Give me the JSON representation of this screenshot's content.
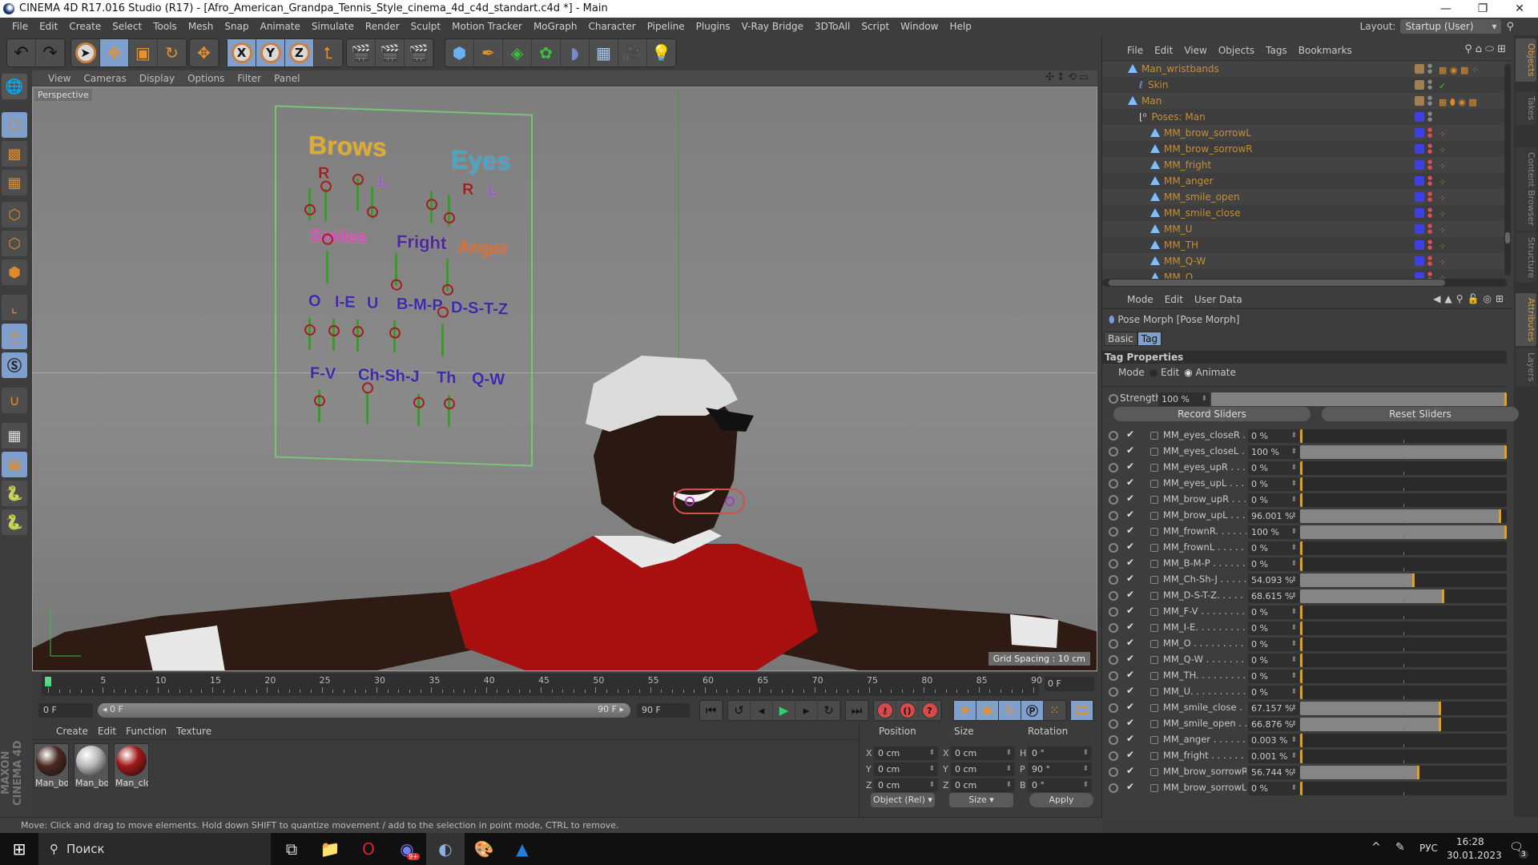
{
  "window": {
    "title": "CINEMA 4D R17.016 Studio (R17) - [Afro_American_Grandpa_Tennis_Style_cinema_4d_c4d_standart.c4d *] - Main",
    "minimize": "—",
    "restore": "❐",
    "close": "✕"
  },
  "menubar": [
    "File",
    "Edit",
    "Create",
    "Select",
    "Tools",
    "Mesh",
    "Snap",
    "Animate",
    "Simulate",
    "Render",
    "Sculpt",
    "Motion Tracker",
    "MoGraph",
    "Character",
    "Pipeline",
    "Plugins",
    "V-Ray Bridge",
    "3DToAll",
    "Script",
    "Window",
    "Help"
  ],
  "layout": {
    "label": "Layout:",
    "value": "Startup (User)"
  },
  "toolbar": {
    "undo": "↶",
    "redo": "↷",
    "axis_x": "X",
    "axis_y": "Y",
    "axis_z": "Z"
  },
  "viewport": {
    "menu": [
      "View",
      "Cameras",
      "Display",
      "Options",
      "Filter",
      "Panel"
    ],
    "camera_label": "Perspective",
    "grid_spacing": "Grid Spacing : 10 cm",
    "board": {
      "brows": "Brows",
      "brows_r": "R",
      "brows_l": "L",
      "eyes": "Eyes",
      "eyes_r": "R",
      "eyes_l": "L",
      "smiles": "Smiles",
      "fright": "Fright",
      "anger": "Anger",
      "o": "O",
      "ie": "I-E",
      "u": "U",
      "bmp": "B-M-P",
      "dstz": "D-S-T-Z",
      "fv": "F-V",
      "chshj": "Ch-Sh-J",
      "th": "Th",
      "qw": "Q-W"
    },
    "colors": {
      "brows": "#d8b030",
      "eyes": "#40a8c8",
      "smiles": "#d050c0",
      "fright": "#4030a0",
      "anger": "#d07030",
      "phoneme": "#3030b0",
      "r": "#902828",
      "l": "#9060d0"
    }
  },
  "timeline": {
    "ticks": [
      "0",
      "5",
      "10",
      "15",
      "20",
      "25",
      "30",
      "35",
      "40",
      "45",
      "50",
      "55",
      "60",
      "65",
      "70",
      "75",
      "80",
      "85",
      "90"
    ],
    "current_frame": "0 F",
    "start_frame": "0 F",
    "range_start": "0 F",
    "range_end": "90 F",
    "end_frame": "90 F"
  },
  "materials": {
    "menu": [
      "Create",
      "Edit",
      "Function",
      "Texture"
    ],
    "items": [
      {
        "label": "Man_bo",
        "color": "#4a2a20"
      },
      {
        "label": "Man_bo",
        "color": "#b8b8b8"
      },
      {
        "label": "Man_clc",
        "color": "#a01818"
      }
    ]
  },
  "coordinates": {
    "headers": {
      "position": "Position",
      "size": "Size",
      "rotation": "Rotation"
    },
    "position": [
      {
        "axis": "X",
        "value": "0 cm"
      },
      {
        "axis": "Y",
        "value": "0 cm"
      },
      {
        "axis": "Z",
        "value": "0 cm"
      }
    ],
    "size": [
      {
        "axis": "X",
        "value": "0 cm"
      },
      {
        "axis": "Y",
        "value": "0 cm"
      },
      {
        "axis": "Z",
        "value": "0 cm"
      }
    ],
    "rotation": [
      {
        "axis": "H",
        "value": "0 °"
      },
      {
        "axis": "P",
        "value": "90 °"
      },
      {
        "axis": "B",
        "value": "0 °"
      }
    ],
    "mode_select": "Object (Rel)",
    "size_select": "Size",
    "apply": "Apply"
  },
  "status": "Move: Click and drag to move elements. Hold down SHIFT to quantize movement / add to the selection in point mode, CTRL to remove.",
  "objects": {
    "menu": [
      "File",
      "Edit",
      "View",
      "Objects",
      "Tags",
      "Bookmarks"
    ],
    "rows": [
      {
        "name": "Man_wristbands",
        "indent": 0,
        "swatch": "#a08050",
        "tags": "▦ ◉ ▩ ⁘"
      },
      {
        "name": "Skin",
        "indent": 1,
        "swatch": "#a08050",
        "tags": "✓"
      },
      {
        "name": "Man",
        "indent": 0,
        "swatch": "#a08050",
        "tags": "▦ ⬮ ◉ ▩"
      },
      {
        "name": "Poses: Man",
        "indent": 1,
        "swatch": "#4040e0",
        "tags": ""
      },
      {
        "name": "MM_brow_sorrowL",
        "indent": 2,
        "swatch": "#4040e0",
        "tags": "⁘"
      },
      {
        "name": "MM_brow_sorrowR",
        "indent": 2,
        "swatch": "#4040e0",
        "tags": "⁘"
      },
      {
        "name": "MM_fright",
        "indent": 2,
        "swatch": "#4040e0",
        "tags": "⁘"
      },
      {
        "name": "MM_anger",
        "indent": 2,
        "swatch": "#4040e0",
        "tags": "⁘"
      },
      {
        "name": "MM_smile_open",
        "indent": 2,
        "swatch": "#4040e0",
        "tags": "⁘"
      },
      {
        "name": "MM_smile_close",
        "indent": 2,
        "swatch": "#4040e0",
        "tags": "⁘"
      },
      {
        "name": "MM_U",
        "indent": 2,
        "swatch": "#4040e0",
        "tags": "⁘"
      },
      {
        "name": "MM_TH",
        "indent": 2,
        "swatch": "#4040e0",
        "tags": "⁘"
      },
      {
        "name": "MM_Q-W",
        "indent": 2,
        "swatch": "#4040e0",
        "tags": "⁘"
      },
      {
        "name": "MM_O",
        "indent": 2,
        "swatch": "#4040e0",
        "tags": "⁘"
      }
    ]
  },
  "side_tabs_top": [
    "Objects",
    "Takes",
    "Content Browser",
    "Structure"
  ],
  "side_tabs_bottom": [
    "Attributes",
    "Layers"
  ],
  "attributes": {
    "menu": [
      "Mode",
      "Edit",
      "User Data"
    ],
    "object_title": "Pose Morph [Pose Morph]",
    "tabs": [
      {
        "label": "Basic",
        "active": false
      },
      {
        "label": "Tag",
        "active": true
      }
    ],
    "section": "Tag Properties",
    "mode_label": "Mode",
    "mode_options": [
      {
        "label": "Edit",
        "selected": false
      },
      {
        "label": "Animate",
        "selected": true
      }
    ],
    "strength_label": "Strength",
    "strength_value": "100 %",
    "strength_fraction": 1.0,
    "record_sliders": "Record Sliders",
    "reset_sliders": "Reset Sliders",
    "sliders": [
      {
        "name": "MM_eyes_closeR . .",
        "value": "0 %",
        "pct": 0
      },
      {
        "name": "MM_eyes_closeL . .",
        "value": "100 %",
        "pct": 100
      },
      {
        "name": "MM_eyes_upR . . . .",
        "value": "0 %",
        "pct": 0
      },
      {
        "name": "MM_eyes_upL . . . .",
        "value": "0 %",
        "pct": 0
      },
      {
        "name": "MM_brow_upR . . .",
        "value": "0 %",
        "pct": 0
      },
      {
        "name": "MM_brow_upL . . .",
        "value": "96.001 %",
        "pct": 96.001
      },
      {
        "name": "MM_frownR. . . . . .",
        "value": "100 %",
        "pct": 100
      },
      {
        "name": "MM_frownL . . . . . .",
        "value": "0 %",
        "pct": 0
      },
      {
        "name": "MM_B-M-P . . . . . . .",
        "value": "0 %",
        "pct": 0
      },
      {
        "name": "MM_Ch-Sh-J . . . . . .",
        "value": "54.093 %",
        "pct": 54.093
      },
      {
        "name": "MM_D-S-T-Z. . . . . .",
        "value": "68.615 %",
        "pct": 68.615
      },
      {
        "name": "MM_F-V . . . . . . . . .",
        "value": "0 %",
        "pct": 0
      },
      {
        "name": "MM_I-E. . . . . . . . . .",
        "value": "0 %",
        "pct": 0
      },
      {
        "name": "MM_O . . . . . . . . . .",
        "value": "0 %",
        "pct": 0
      },
      {
        "name": "MM_Q-W . . . . . . . .",
        "value": "0 %",
        "pct": 0
      },
      {
        "name": "MM_TH. . . . . . . . . .",
        "value": "0 %",
        "pct": 0
      },
      {
        "name": "MM_U. . . . . . . . . . .",
        "value": "0 %",
        "pct": 0
      },
      {
        "name": "MM_smile_close . .",
        "value": "67.157 %",
        "pct": 67.157
      },
      {
        "name": "MM_smile_open . .",
        "value": "66.876 %",
        "pct": 66.876
      },
      {
        "name": "MM_anger . . . . . . .",
        "value": "0.003 %",
        "pct": 0.003
      },
      {
        "name": "MM_fright . . . . . . .",
        "value": "0.001 %",
        "pct": 0.001
      },
      {
        "name": "MM_brow_sorrowR",
        "value": "56.744 %",
        "pct": 56.744
      },
      {
        "name": "MM_brow_sorrowL",
        "value": "0 %",
        "pct": 0
      }
    ]
  },
  "taskbar": {
    "search_placeholder": "Поиск",
    "language": "РУС",
    "time": "16:28",
    "date": "30.01.2023",
    "notifications": "3",
    "discord_badge": "9+"
  }
}
